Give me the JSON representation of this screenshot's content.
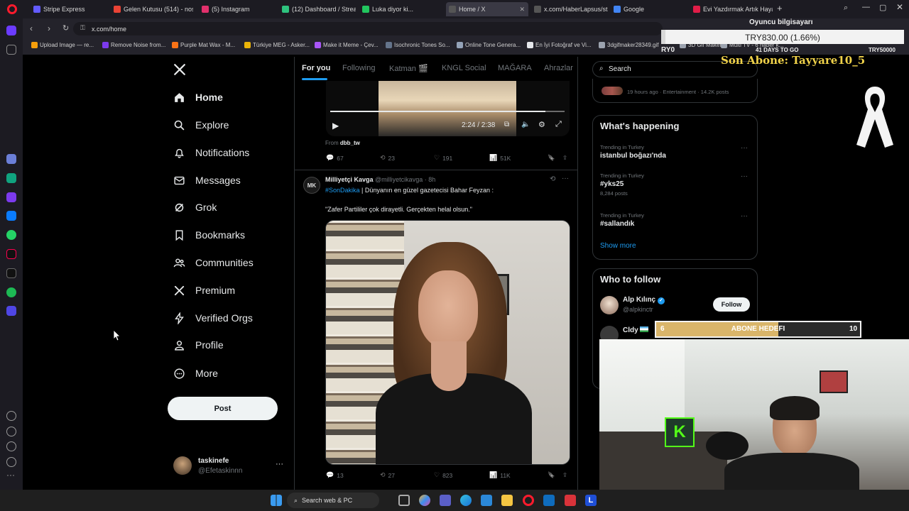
{
  "tabs": [
    {
      "label": "Stripe Express",
      "color": "#635bff"
    },
    {
      "label": "Gelen Kutusu (514) - nosr",
      "color": "#ea4335"
    },
    {
      "label": "(5) Instagram",
      "color": "#e1306c"
    },
    {
      "label": "(12) Dashboard / Streaml",
      "color": "#2ec27e"
    },
    {
      "label": "Luka diyor ki...",
      "color": "#22c55e"
    },
    {
      "label": "Home / X",
      "color": "#555555",
      "active": true
    },
    {
      "label": "x.com/HaberLapsus/statu",
      "color": "#555555"
    },
    {
      "label": "Google",
      "color": "#4285f4"
    },
    {
      "label": "Evi Yazdırmak Artık Hayal",
      "color": "#e11d48"
    }
  ],
  "url": "x.com/home",
  "bookmarks": [
    {
      "label": "Upload Image — re...",
      "color": "#f59e0b"
    },
    {
      "label": "Remove Noise from...",
      "color": "#7c3aed"
    },
    {
      "label": "Purple Mat Wax - M...",
      "color": "#f97316"
    },
    {
      "label": "Türkiye MEG - Asker...",
      "color": "#eab308"
    },
    {
      "label": "Make it Meme - Çev...",
      "color": "#a855f7"
    },
    {
      "label": "Isochronic Tones So...",
      "color": "#64748b"
    },
    {
      "label": "Online Tone Genera...",
      "color": "#94a3b8"
    },
    {
      "label": "En İyi Fotoğraf ve Vi...",
      "color": "#e5e7eb"
    },
    {
      "label": "3dgifmaker28349.gif",
      "color": "#9ca3af"
    },
    {
      "label": "3D Gif Maker",
      "color": "#9ca3af"
    },
    {
      "label": "Multi TV - 6 haber k...",
      "color": "#9ca3af"
    }
  ],
  "nav": [
    {
      "label": "Home",
      "icon": "home-icon",
      "bold": true
    },
    {
      "label": "Explore",
      "icon": "search-icon"
    },
    {
      "label": "Notifications",
      "icon": "bell-icon"
    },
    {
      "label": "Messages",
      "icon": "mail-icon"
    },
    {
      "label": "Grok",
      "icon": "grok-icon"
    },
    {
      "label": "Bookmarks",
      "icon": "bookmark-icon"
    },
    {
      "label": "Communities",
      "icon": "people-icon"
    },
    {
      "label": "Premium",
      "icon": "x-icon"
    },
    {
      "label": "Verified Orgs",
      "icon": "bolt-icon"
    },
    {
      "label": "Profile",
      "icon": "user-icon"
    },
    {
      "label": "More",
      "icon": "more-circle-icon"
    }
  ],
  "post_button": "Post",
  "account": {
    "name": "taskinefe",
    "handle": "@Efetaskinnn",
    "more": "···"
  },
  "feed_tabs": [
    "For you",
    "Following",
    "Katman 🎬",
    "KNGL Social",
    "MAĞARA",
    "Ahrazlar"
  ],
  "video": {
    "time": "2:24 / 2:38",
    "from_label": "From",
    "from_handle": "dbb_tw"
  },
  "tweet1_actions": {
    "replies": "67",
    "reposts": "23",
    "likes": "191",
    "views": "51K"
  },
  "tweet2": {
    "author": "Milliyetçi Kavga",
    "handle": "@milliyetcikavga · 8h",
    "avatar": "MK",
    "hashtag": "#SonDakika",
    "line1": "| Dünyanın en güzel gazetecisi Bahar Feyzan :",
    "line2": "\"Zafer Partililer çok dirayetli. Gerçekten helal olsun.\"",
    "replies": "13",
    "reposts": "27",
    "likes": "823",
    "views": "11K"
  },
  "search": {
    "placeholder": "Search"
  },
  "top_trend_meta": "19 hours ago · Entertainment · 14.2K posts",
  "whats_happening": {
    "title": "What's happening",
    "trends": [
      {
        "meta": "Trending in Turkey",
        "name": "istanbul boğazı'nda",
        "count": ""
      },
      {
        "meta": "Trending in Turkey",
        "name": "#yks25",
        "count": "8,284 posts"
      },
      {
        "meta": "Trending in Turkey",
        "name": "#sallandık",
        "count": ""
      }
    ],
    "show_more": "Show more"
  },
  "who_to_follow": {
    "title": "Who to follow",
    "users": [
      {
        "name": "Alp Kılınç",
        "handle": "@alpkinctr"
      },
      {
        "name": "Cldy",
        "handle": ""
      }
    ],
    "follow_label": "Follow"
  },
  "overlay": {
    "goal_title": "Oyuncu bilgisayarı",
    "goal_amount": "TRY830.00 (1.66%)",
    "goal_progress": 0.0166,
    "goal_left": "RY0",
    "goal_mid": "41 DAYS TO GO",
    "goal_right": "TRY50000",
    "sub_label": "Son Abone: Tayyare10_5",
    "abone_current": "6",
    "abone_title": "ABONE HEDEFI",
    "abone_target": "10",
    "abone_progress": 0.6
  },
  "taskbar": {
    "search_label": "Search web & PC"
  }
}
